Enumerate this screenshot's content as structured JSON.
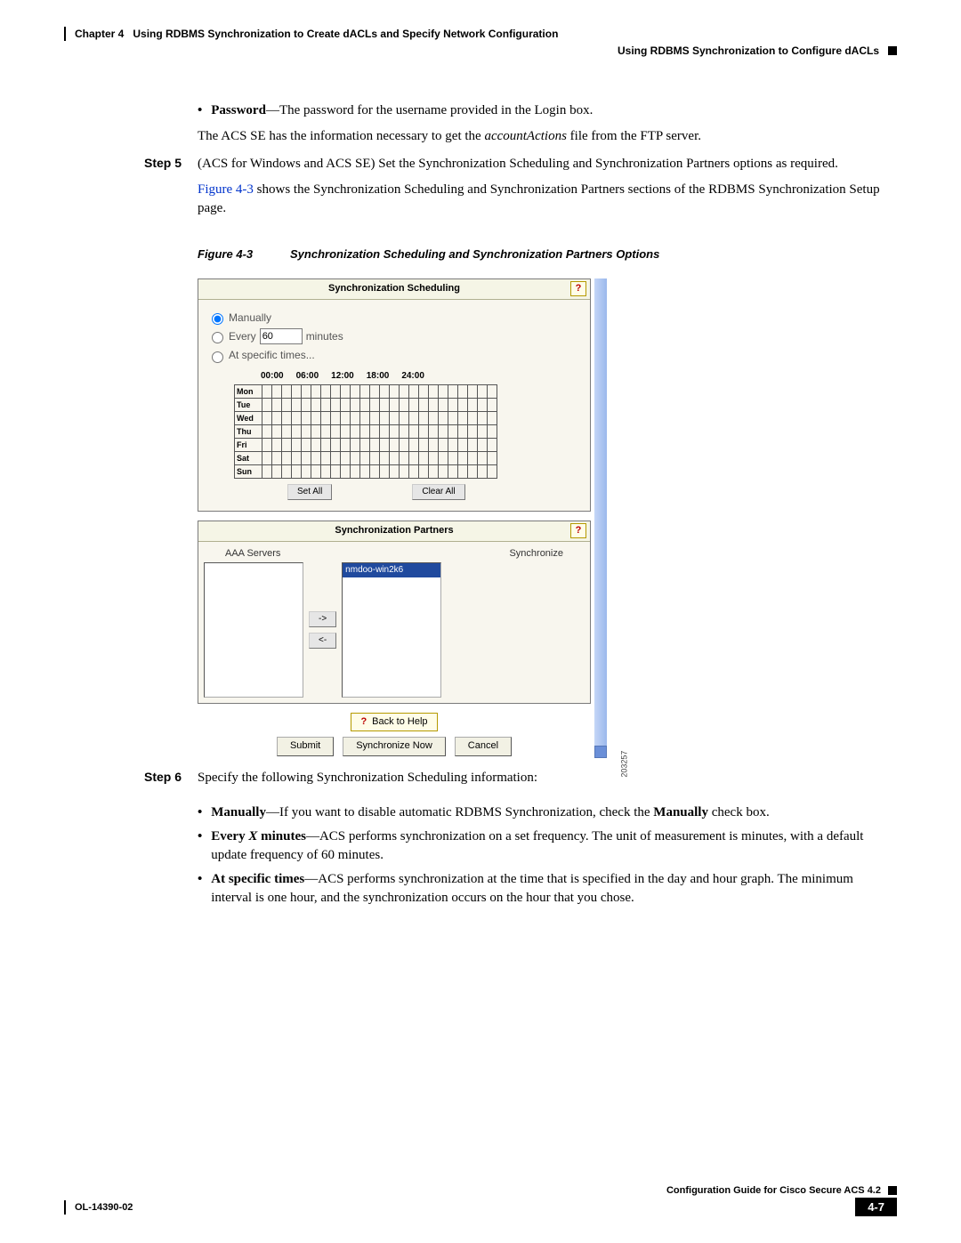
{
  "header": {
    "chapter_label": "Chapter 4",
    "chapter_title": "Using RDBMS Synchronization to Create dACLs and Specify Network Configuration",
    "section_title": "Using RDBMS Synchronization to Configure dACLs"
  },
  "body": {
    "pw_label": "Password",
    "pw_text": "—The password for the username provided in the Login box.",
    "acs_se_line_pre": "The ACS SE has the information necessary to get the ",
    "acs_se_file": "accountActions",
    "acs_se_line_post": " file from the FTP server.",
    "step5_label": "Step 5",
    "step5_para1": "(ACS for Windows and ACS SE) Set the Synchronization Scheduling and Synchronization Partners options as required.",
    "step5_figref": "Figure 4-3",
    "step5_para2": " shows the Synchronization Scheduling and Synchronization Partners sections of the RDBMS Synchronization Setup page.",
    "figure_no": "Figure 4-3",
    "figure_title": "Synchronization Scheduling and Synchronization Partners Options",
    "step6_label": "Step 6",
    "step6_intro": "Specify the following Synchronization Scheduling information:",
    "manual_label": "Manually",
    "manual_text_pre": "—If you want to disable automatic RDBMS Synchronization, check the ",
    "manual_bold": "Manually",
    "manual_text_post": " check box.",
    "every_label_pre": "Every ",
    "every_x": "X",
    "every_label_post": " minutes",
    "every_text": "—ACS performs synchronization on a set frequency. The unit of measurement is minutes, with a default update frequency of 60 minutes.",
    "at_label": "At specific times",
    "at_text": "—ACS performs synchronization at the time that is specified in the day and hour graph. The minimum interval is one hour, and the synchronization occurs on the hour that you chose."
  },
  "ui": {
    "sched_title": "Synchronization Scheduling",
    "opt_manually": "Manually",
    "opt_every": "Every",
    "opt_every_val": "60",
    "opt_every_unit": "minutes",
    "opt_specific": "At specific times...",
    "time_labels": [
      "00:00",
      "06:00",
      "12:00",
      "18:00",
      "24:00"
    ],
    "days": [
      "Mon",
      "Tue",
      "Wed",
      "Thu",
      "Fri",
      "Sat",
      "Sun"
    ],
    "set_all": "Set All",
    "clear_all": "Clear All",
    "partners_title": "Synchronization Partners",
    "aaa_label": "AAA Servers",
    "sync_label": "Synchronize",
    "partner_item": "nmdoo-win2k6",
    "move_right": "->",
    "move_left": "<-",
    "back_to_help": "Back to Help",
    "submit": "Submit",
    "sync_now": "Synchronize Now",
    "cancel": "Cancel",
    "figure_id": "203257",
    "help_glyph": "?"
  },
  "footer": {
    "guide": "Configuration Guide for Cisco Secure ACS 4.2",
    "doc_id": "OL-14390-02",
    "page_no": "4-7"
  }
}
